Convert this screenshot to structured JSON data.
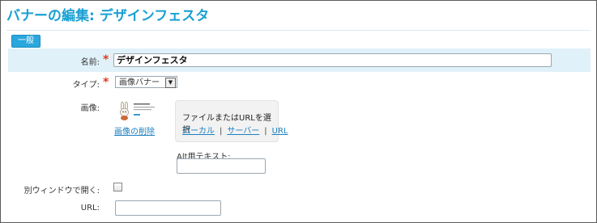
{
  "page": {
    "title": "バナーの編集: デザインフェスタ",
    "section_tab": "一般"
  },
  "form": {
    "name": {
      "label": "名前:",
      "required_mark": "*",
      "value": "デザインフェスタ"
    },
    "type": {
      "label": "タイプ:",
      "required_mark": "*",
      "selected": "画像バナー",
      "arrow_icon": "chevron-down-icon"
    },
    "image": {
      "label": "画像:",
      "delete_link": "画像の削除",
      "picker_title": "ファイルまたはURLを選択",
      "picker_links": {
        "local": "ローカル",
        "separator1": "|",
        "server": "サーバー",
        "separator2": "|",
        "url": "URL"
      }
    },
    "alt_text": {
      "label": "Alt用テキスト:",
      "value": ""
    },
    "open_new_window": {
      "label": "別ウィンドウで開く:",
      "checked": false
    },
    "url": {
      "label": "URL:",
      "value": ""
    }
  },
  "colors": {
    "title": "#1aa0d3",
    "accent": "#2aa7dc",
    "highlight_row": "#e0f1f9",
    "required": "#e33b1c",
    "link": "#1a7fc0"
  }
}
